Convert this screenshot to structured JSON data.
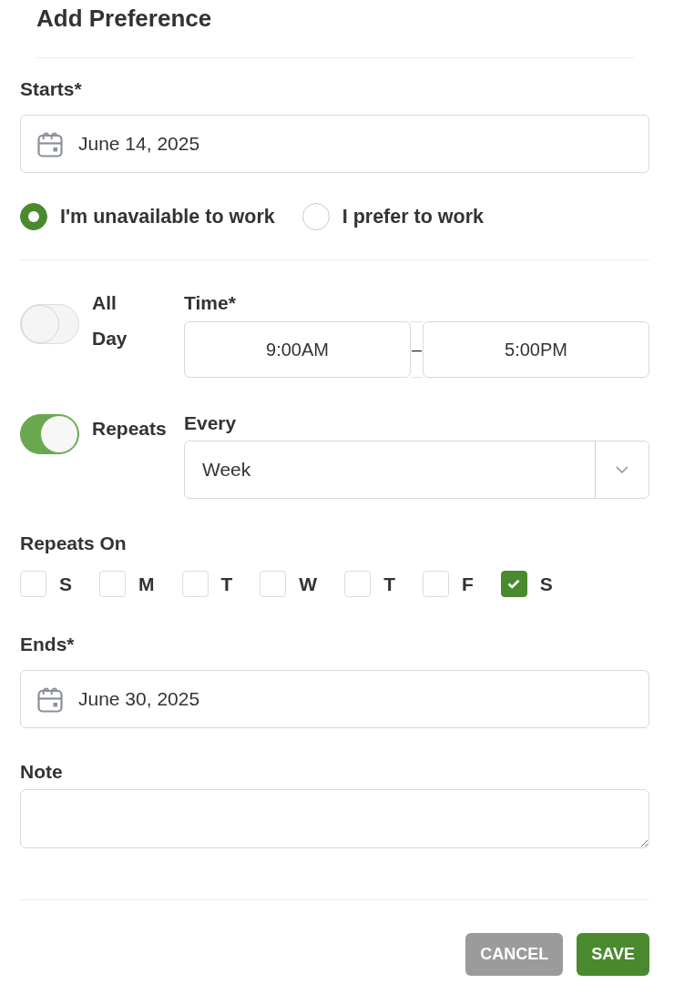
{
  "title": "Add Preference",
  "starts": {
    "label": "Starts*",
    "value": "June 14, 2025"
  },
  "availability": [
    {
      "label": "I'm unavailable to work",
      "selected": true
    },
    {
      "label": "I prefer to work",
      "selected": false
    }
  ],
  "all_day": {
    "label": "All Day",
    "on": false
  },
  "time": {
    "label": "Time*",
    "start": "9:00AM",
    "separator": "–",
    "end": "5:00PM"
  },
  "repeats": {
    "label": "Repeats",
    "on": true
  },
  "every": {
    "label": "Every",
    "value": "Week"
  },
  "repeats_on": {
    "label": "Repeats On",
    "days": [
      {
        "label": "S",
        "checked": false
      },
      {
        "label": "M",
        "checked": false
      },
      {
        "label": "T",
        "checked": false
      },
      {
        "label": "W",
        "checked": false
      },
      {
        "label": "T",
        "checked": false
      },
      {
        "label": "F",
        "checked": false
      },
      {
        "label": "S",
        "checked": true
      }
    ]
  },
  "ends": {
    "label": "Ends*",
    "value": "June 30, 2025"
  },
  "note": {
    "label": "Note"
  },
  "buttons": [
    {
      "label": "CANCEL",
      "kind": "secondary"
    },
    {
      "label": "SAVE",
      "kind": "primary"
    }
  ]
}
